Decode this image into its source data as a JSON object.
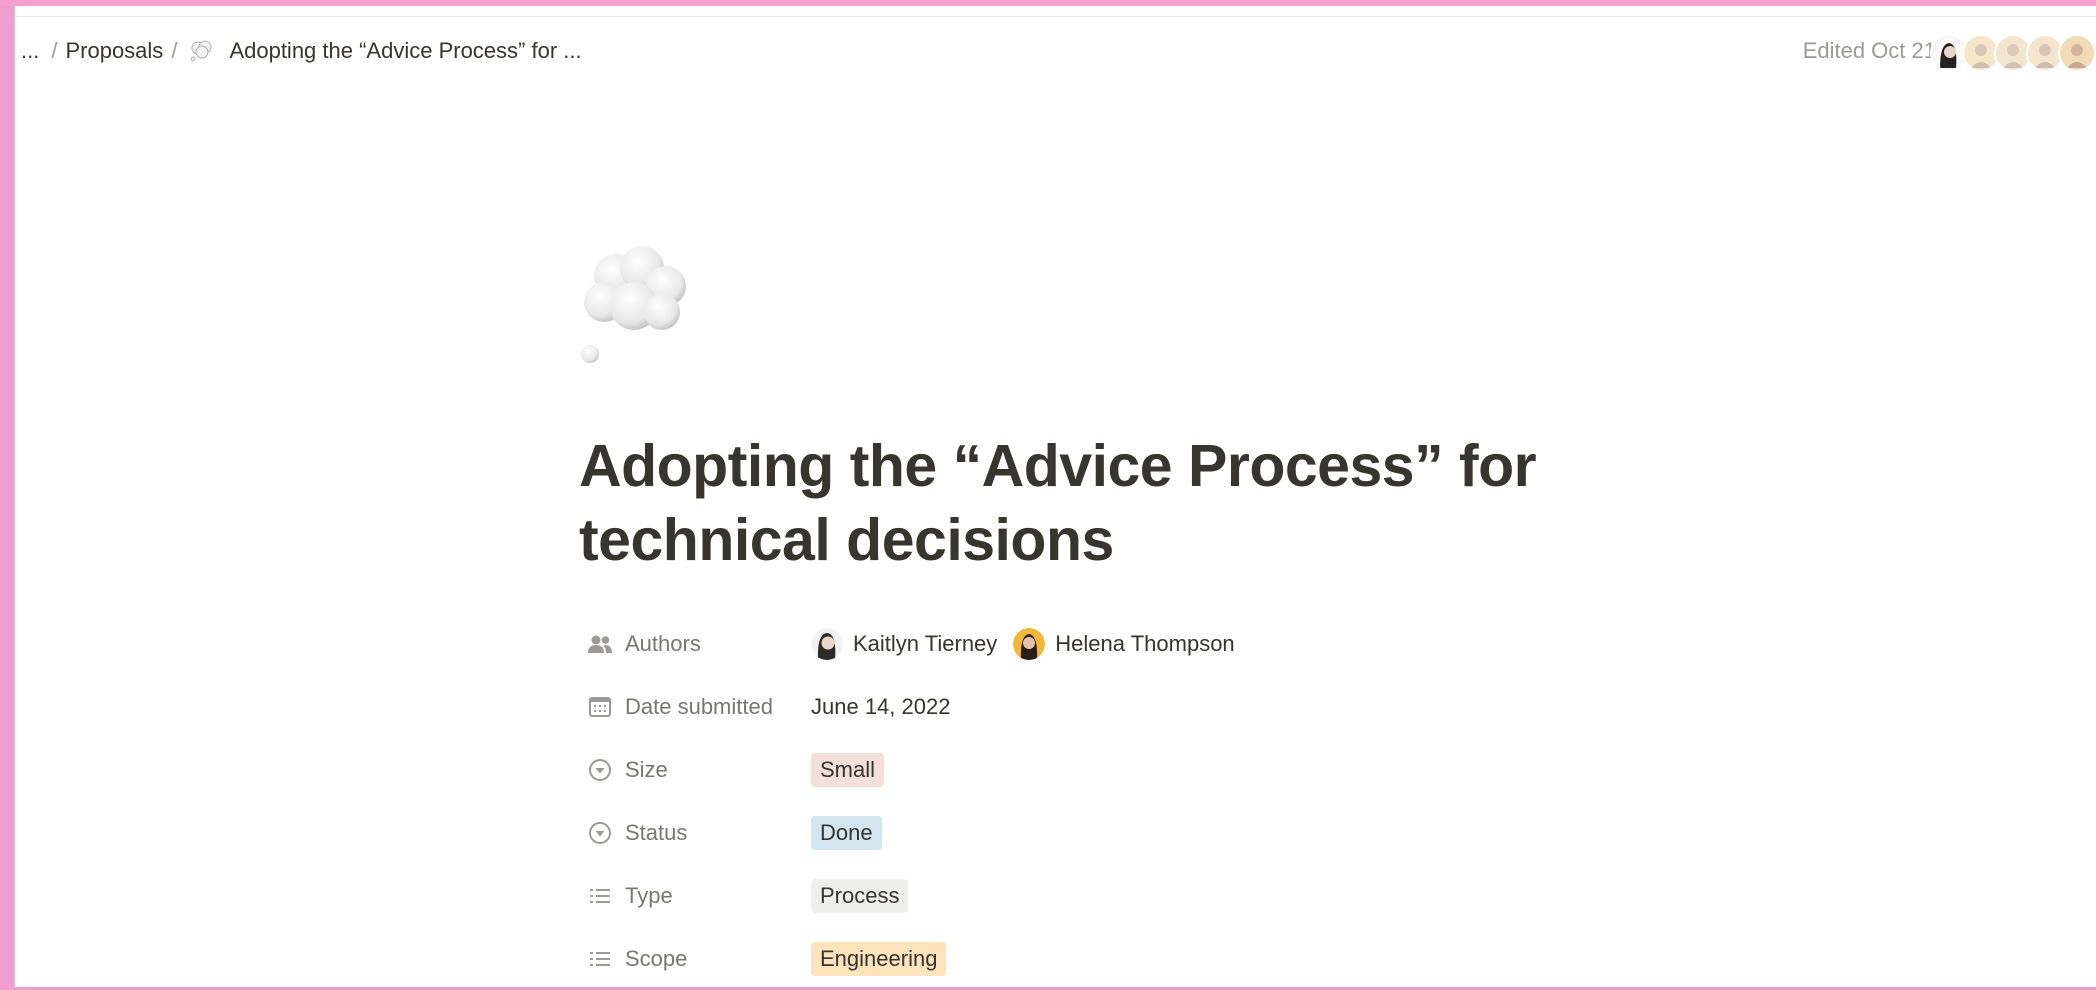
{
  "breadcrumb": {
    "ellipsis": "...",
    "sep1": "/",
    "parent": "Proposals",
    "sep2": "/",
    "current": "Adopting the “Advice Process” for ..."
  },
  "header": {
    "edited": "Edited Oct 21",
    "avatar_icons": [
      "avatar-icon",
      "avatar-icon",
      "avatar-icon",
      "avatar-icon",
      "avatar-icon"
    ]
  },
  "page": {
    "icon": "thought-balloon-icon",
    "title": "Adopting the “Advice Process” for technical decisions"
  },
  "properties": {
    "authors": {
      "label": "Authors",
      "people": [
        {
          "name": "Kaitlyn Tierney"
        },
        {
          "name": "Helena Thompson"
        }
      ]
    },
    "date_submitted": {
      "label": "Date submitted",
      "value": "June 14, 2022"
    },
    "size": {
      "label": "Size",
      "value": "Small",
      "color": "#f4dfdb"
    },
    "status": {
      "label": "Status",
      "value": "Done",
      "color": "#d3e5ef"
    },
    "type": {
      "label": "Type",
      "value": "Process",
      "color": "#efefed"
    },
    "scope": {
      "label": "Scope",
      "value": "Engineering",
      "color": "#fde4bc"
    }
  }
}
